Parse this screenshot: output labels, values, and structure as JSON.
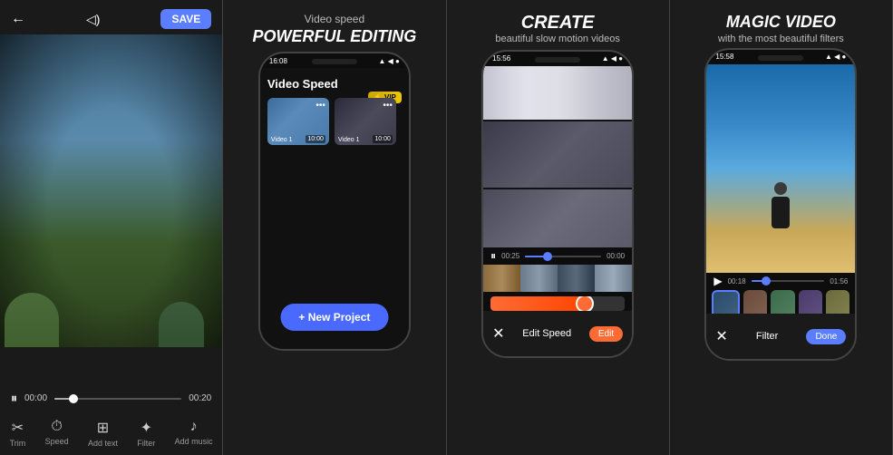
{
  "panel1": {
    "save_label": "SAVE",
    "time_start": "00:00",
    "time_end": "00:20",
    "tools": [
      {
        "icon": "✂",
        "label": "Trim"
      },
      {
        "icon": "⏱",
        "label": "Speed"
      },
      {
        "icon": "⊞",
        "label": "Add text"
      },
      {
        "icon": "✦",
        "label": "Filter"
      },
      {
        "icon": "♪",
        "label": "Add music"
      }
    ]
  },
  "panel2": {
    "subtitle": "Video speed",
    "title": "POWERFUL EDITING",
    "phone": {
      "status_left": "16:08",
      "status_right": "▲ ◀ ●",
      "section_title": "Video Speed",
      "vip_label": "⚡ VIP",
      "thumb1_label": "Video 1",
      "thumb1_duration": "10:00",
      "thumb2_label": "Video 1",
      "thumb2_duration": "10:00",
      "new_project_label": "+ New Project"
    }
  },
  "panel3": {
    "title": "CREATE",
    "subtitle": "beautiful slow motion videos",
    "phone": {
      "status_left": "15:56",
      "status_right": "▲ ◀ ●",
      "time_start": "00:25",
      "time_end": "00:00",
      "edit_speed_label": "Edit Speed",
      "edit_btn_label": "Edit"
    }
  },
  "panel4": {
    "title": "MAGIC VIDEO",
    "subtitle": "with the most beautiful filters",
    "phone": {
      "status_left": "15:58",
      "status_right": "▲ ◀ ●",
      "time_start": "00:18",
      "time_end": "01:56",
      "filter_label": "Filter",
      "done_label": "Done"
    }
  }
}
